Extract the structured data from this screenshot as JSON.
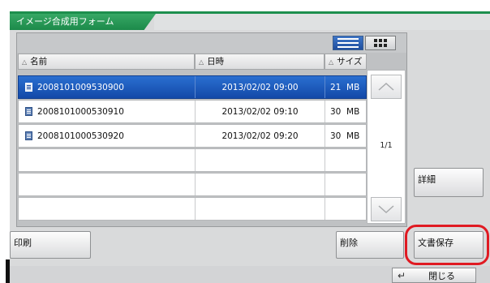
{
  "window": {
    "title": "イメージ合成用フォーム"
  },
  "view_toggle": {
    "list_icon": "list-view-icon",
    "thumb_icon": "thumbnail-view-icon"
  },
  "columns": {
    "name": "名前",
    "datetime": "日時",
    "size": "サイズ",
    "sort_icon": "sort-triangle-icon"
  },
  "rows": [
    {
      "name": "2008101009530900",
      "datetime": "2013/02/02 09:00",
      "size": "21  MB",
      "selected": true
    },
    {
      "name": "2008101000530910",
      "datetime": "2013/02/02 09:10",
      "size": "30  MB",
      "selected": false
    },
    {
      "name": "2008101000530920",
      "datetime": "2013/02/02 09:20",
      "size": "30  MB",
      "selected": false
    }
  ],
  "pagination": {
    "indicator": "1/1",
    "up_icon": "chevron-up-icon",
    "down_icon": "chevron-down-icon"
  },
  "buttons": {
    "detail": "詳細",
    "save": "文書保存",
    "delete": "削除",
    "print": "印刷",
    "close": "閉じる",
    "close_icon": "return-arrow-icon"
  },
  "colors": {
    "titlebar": "#1c8a4a",
    "selection": "#1f4e9e",
    "highlight": "#e01a22"
  }
}
